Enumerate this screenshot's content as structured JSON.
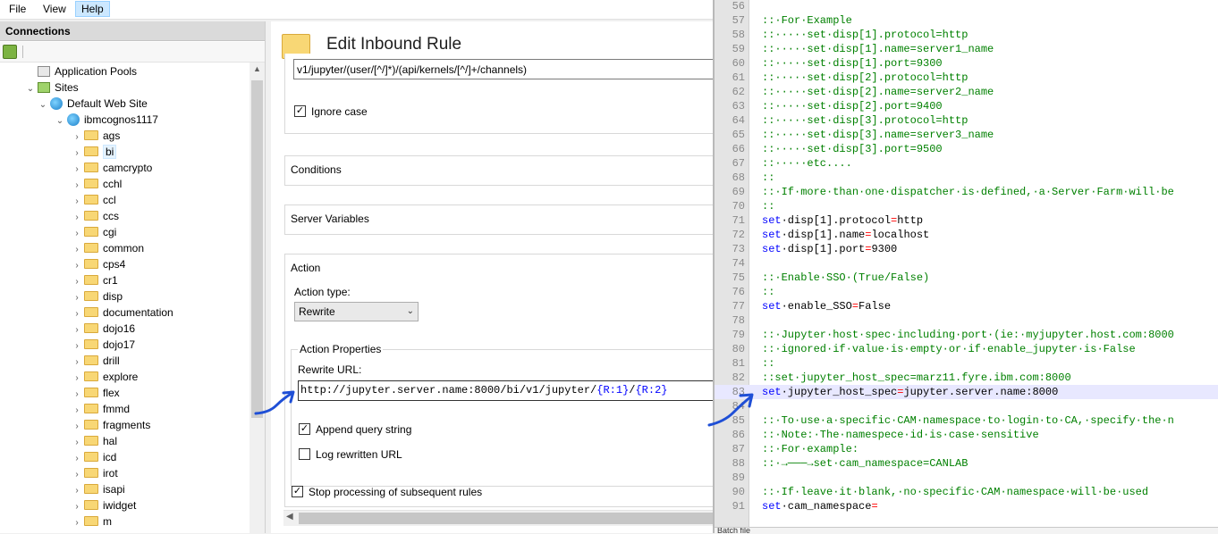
{
  "menu": {
    "items": [
      "File",
      "View",
      "Help"
    ],
    "active": "Help"
  },
  "connections": {
    "title": "Connections",
    "tree": [
      {
        "label": "Application Pools",
        "kind": "pool",
        "level": 1,
        "chevron": ""
      },
      {
        "label": "Sites",
        "kind": "sites",
        "level": 1,
        "chevron": "⌄"
      },
      {
        "label": "Default Web Site",
        "kind": "globe",
        "level": 2,
        "chevron": "⌄"
      },
      {
        "label": "ibmcognos1117",
        "kind": "globe",
        "level": 3,
        "chevron": "⌄"
      },
      {
        "label": "ags",
        "kind": "folder",
        "level": 4,
        "chevron": "›"
      },
      {
        "label": "bi",
        "kind": "folder",
        "level": 4,
        "chevron": "›",
        "selected": true
      },
      {
        "label": "camcrypto",
        "kind": "folder",
        "level": 4,
        "chevron": "›"
      },
      {
        "label": "cchl",
        "kind": "folder",
        "level": 4,
        "chevron": "›"
      },
      {
        "label": "ccl",
        "kind": "folder",
        "level": 4,
        "chevron": "›"
      },
      {
        "label": "ccs",
        "kind": "folder",
        "level": 4,
        "chevron": "›"
      },
      {
        "label": "cgi",
        "kind": "folder",
        "level": 4,
        "chevron": "›"
      },
      {
        "label": "common",
        "kind": "folder",
        "level": 4,
        "chevron": "›"
      },
      {
        "label": "cps4",
        "kind": "folder",
        "level": 4,
        "chevron": "›"
      },
      {
        "label": "cr1",
        "kind": "folder",
        "level": 4,
        "chevron": "›"
      },
      {
        "label": "disp",
        "kind": "folder",
        "level": 4,
        "chevron": "›"
      },
      {
        "label": "documentation",
        "kind": "folder",
        "level": 4,
        "chevron": "›"
      },
      {
        "label": "dojo16",
        "kind": "folder",
        "level": 4,
        "chevron": "›"
      },
      {
        "label": "dojo17",
        "kind": "folder",
        "level": 4,
        "chevron": "›"
      },
      {
        "label": "drill",
        "kind": "folder",
        "level": 4,
        "chevron": "›"
      },
      {
        "label": "explore",
        "kind": "folder",
        "level": 4,
        "chevron": "›"
      },
      {
        "label": "flex",
        "kind": "folder",
        "level": 4,
        "chevron": "›"
      },
      {
        "label": "fmmd",
        "kind": "folder",
        "level": 4,
        "chevron": "›"
      },
      {
        "label": "fragments",
        "kind": "folder",
        "level": 4,
        "chevron": "›"
      },
      {
        "label": "hal",
        "kind": "folder",
        "level": 4,
        "chevron": "›"
      },
      {
        "label": "icd",
        "kind": "folder",
        "level": 4,
        "chevron": "›"
      },
      {
        "label": "irot",
        "kind": "folder",
        "level": 4,
        "chevron": "›"
      },
      {
        "label": "isapi",
        "kind": "folder",
        "level": 4,
        "chevron": "›"
      },
      {
        "label": "iwidget",
        "kind": "folder",
        "level": 4,
        "chevron": "›"
      },
      {
        "label": "m",
        "kind": "folder",
        "level": 4,
        "chevron": "›"
      }
    ]
  },
  "edit_rule": {
    "title": "Edit Inbound Rule",
    "pattern": "v1/jupyter/(user/[^/]*)/(api/kernels/[^/]+/channels)",
    "ignore_case_label": "Ignore case",
    "ignore_case_checked": true,
    "conditions_label": "Conditions",
    "server_variables_label": "Server Variables",
    "action_label": "Action",
    "action_type_label": "Action type:",
    "action_type_value": "Rewrite",
    "action_properties_label": "Action Properties",
    "rewrite_url_label": "Rewrite URL:",
    "rewrite_url_prefix": "http://jupyter.server.name:8000/bi/v1/jupyter/",
    "rewrite_url_r1": "{R:1}",
    "rewrite_url_sep": "/",
    "rewrite_url_r2": "{R:2}",
    "append_query_label": "Append query string",
    "append_query_checked": true,
    "log_rewritten_label": "Log rewritten URL",
    "log_rewritten_checked": false,
    "stop_processing_label": "Stop processing of subsequent rules",
    "stop_processing_checked": true
  },
  "code": {
    "highlighted_line": 83,
    "lines": [
      {
        "n": "56",
        "segs": []
      },
      {
        "n": "57",
        "segs": [
          {
            "c": "cmt",
            "t": "::·For·Example"
          }
        ]
      },
      {
        "n": "58",
        "segs": [
          {
            "c": "cmt",
            "t": "::·····set·disp[1].protocol=http"
          }
        ]
      },
      {
        "n": "59",
        "segs": [
          {
            "c": "cmt",
            "t": "::·····set·disp[1].name=server1_name"
          }
        ]
      },
      {
        "n": "60",
        "segs": [
          {
            "c": "cmt",
            "t": "::·····set·disp[1].port=9300"
          }
        ]
      },
      {
        "n": "61",
        "segs": [
          {
            "c": "cmt",
            "t": "::·····set·disp[2].protocol=http"
          }
        ]
      },
      {
        "n": "62",
        "segs": [
          {
            "c": "cmt",
            "t": "::·····set·disp[2].name=server2_name"
          }
        ]
      },
      {
        "n": "63",
        "segs": [
          {
            "c": "cmt",
            "t": "::·····set·disp[2].port=9400"
          }
        ]
      },
      {
        "n": "64",
        "segs": [
          {
            "c": "cmt",
            "t": "::·····set·disp[3].protocol=http"
          }
        ]
      },
      {
        "n": "65",
        "segs": [
          {
            "c": "cmt",
            "t": "::·····set·disp[3].name=server3_name"
          }
        ]
      },
      {
        "n": "66",
        "segs": [
          {
            "c": "cmt",
            "t": "::·····set·disp[3].port=9500"
          }
        ]
      },
      {
        "n": "67",
        "segs": [
          {
            "c": "cmt",
            "t": "::·····etc...."
          }
        ]
      },
      {
        "n": "68",
        "segs": [
          {
            "c": "cmt",
            "t": "::"
          }
        ]
      },
      {
        "n": "69",
        "segs": [
          {
            "c": "cmt",
            "t": "::·If·more·than·one·dispatcher·is·defined,·a·Server·Farm·will·be"
          }
        ]
      },
      {
        "n": "70",
        "segs": [
          {
            "c": "cmt",
            "t": "::"
          }
        ]
      },
      {
        "n": "71",
        "segs": [
          {
            "c": "kw",
            "t": "set"
          },
          {
            "c": "blk",
            "t": "·disp[1].protocol"
          },
          {
            "c": "red",
            "t": "="
          },
          {
            "c": "blk",
            "t": "http"
          }
        ]
      },
      {
        "n": "72",
        "segs": [
          {
            "c": "kw",
            "t": "set"
          },
          {
            "c": "blk",
            "t": "·disp[1].name"
          },
          {
            "c": "red",
            "t": "="
          },
          {
            "c": "blk",
            "t": "localhost"
          }
        ]
      },
      {
        "n": "73",
        "segs": [
          {
            "c": "kw",
            "t": "set"
          },
          {
            "c": "blk",
            "t": "·disp[1].port"
          },
          {
            "c": "red",
            "t": "="
          },
          {
            "c": "blk",
            "t": "9300"
          }
        ]
      },
      {
        "n": "74",
        "segs": []
      },
      {
        "n": "75",
        "segs": [
          {
            "c": "cmt",
            "t": "::·Enable·SSO·(True/False)"
          }
        ]
      },
      {
        "n": "76",
        "segs": [
          {
            "c": "cmt",
            "t": "::"
          }
        ]
      },
      {
        "n": "77",
        "segs": [
          {
            "c": "kw",
            "t": "set"
          },
          {
            "c": "blk",
            "t": "·enable_SSO"
          },
          {
            "c": "red",
            "t": "="
          },
          {
            "c": "blk",
            "t": "False"
          }
        ]
      },
      {
        "n": "78",
        "segs": []
      },
      {
        "n": "79",
        "segs": [
          {
            "c": "cmt",
            "t": "::·Jupyter·host·spec·including·port·(ie:·myjupyter.host.com:8000"
          }
        ]
      },
      {
        "n": "80",
        "segs": [
          {
            "c": "cmt",
            "t": "::·ignored·if·value·is·empty·or·if·enable_jupyter·is·False"
          }
        ]
      },
      {
        "n": "81",
        "segs": [
          {
            "c": "cmt",
            "t": "::"
          }
        ]
      },
      {
        "n": "82",
        "segs": [
          {
            "c": "cmt",
            "t": "::set·jupyter_host_spec=marz11.fyre.ibm.com:8000"
          }
        ]
      },
      {
        "n": "83",
        "segs": [
          {
            "c": "kw",
            "t": "set"
          },
          {
            "c": "blk",
            "t": "·jupyter_host_spec"
          },
          {
            "c": "red",
            "t": "="
          },
          {
            "c": "blk",
            "t": "jupyter.server.name:8000"
          }
        ]
      },
      {
        "n": "84",
        "segs": []
      },
      {
        "n": "85",
        "segs": [
          {
            "c": "cmt",
            "t": "::·To·use·a·specific·CAM·namespace·to·login·to·CA,·specify·the·n"
          }
        ]
      },
      {
        "n": "86",
        "segs": [
          {
            "c": "cmt",
            "t": "::·Note:·The·namespece·id·is·case·sensitive"
          }
        ]
      },
      {
        "n": "87",
        "segs": [
          {
            "c": "cmt",
            "t": "::·For·example:"
          }
        ]
      },
      {
        "n": "88",
        "segs": [
          {
            "c": "cmt",
            "t": "::·→───→set·cam_namespace=CANLAB"
          }
        ]
      },
      {
        "n": "89",
        "segs": []
      },
      {
        "n": "90",
        "segs": [
          {
            "c": "cmt",
            "t": "::·If·leave·it·blank,·no·specific·CAM·namespace·will·be·used"
          }
        ]
      },
      {
        "n": "91",
        "segs": [
          {
            "c": "kw",
            "t": "set"
          },
          {
            "c": "blk",
            "t": "·cam_namespace"
          },
          {
            "c": "red",
            "t": "="
          }
        ]
      }
    ],
    "status_text": "Batch file"
  },
  "colors": {
    "annotation_arrow": "#1f4fd6",
    "comment": "#008000",
    "keyword": "#0000ff",
    "operator": "#ff0000"
  }
}
